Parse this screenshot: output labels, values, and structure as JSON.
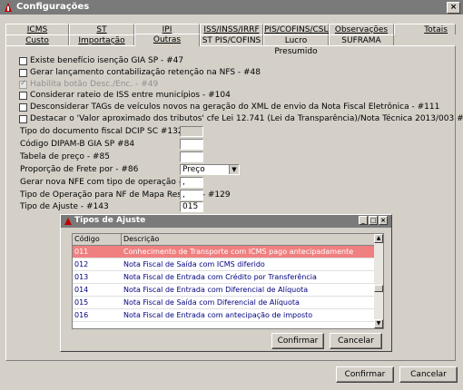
{
  "window": {
    "title": "Configurações",
    "close": "×"
  },
  "tabs_row1": [
    "ICMS",
    "ST",
    "IPI",
    "ISS/INSS/IRRF",
    "PIS/COFINS/CSLL",
    "Observações",
    "Totais"
  ],
  "tabs_row2": [
    "Custo",
    "Importação",
    "Outras",
    "ST PIS/COFINS",
    "Lucro Presumido",
    "SUFRAMA"
  ],
  "checkboxes": [
    {
      "label": "Existe benefício isenção GIA SP - #47",
      "checked": false,
      "disabled": false
    },
    {
      "label": "Gerar lançamento contabilização retenção na NFS - #48",
      "checked": false,
      "disabled": false
    },
    {
      "label": "Habilita botão Desc./Enc. - #49",
      "checked": true,
      "disabled": true
    },
    {
      "label": "Considerar rateio de ISS entre municípios - #104",
      "checked": false,
      "disabled": false
    },
    {
      "label": "Desconsiderar TAGs de veículos novos na geração do XML de envio da Nota Fiscal Eletrônica - #111",
      "checked": false,
      "disabled": false
    },
    {
      "label": "Destacar o 'Valor aproximado dos tributos' cfe Lei 12.741 (Lei da Transparência)/Nota Técnica 2013/003 #130",
      "checked": false,
      "disabled": false
    }
  ],
  "fields": {
    "tipo_doc": {
      "label": "Tipo do documento fiscal DCIP SC #132",
      "value": ""
    },
    "codigo_dipam": {
      "label": "Código DIPAM-B GIA SP  #84",
      "value": ""
    },
    "tabela_preco": {
      "label": "Tabela de preço - #85",
      "value": ""
    },
    "proporcao_frete": {
      "label": "Proporção de Frete por - #86",
      "value": "Preço"
    },
    "gerar_nfe": {
      "label": "Gerar nova NFE com tipo de operação - #88",
      "value": ","
    },
    "tipo_operacao": {
      "label": "Tipo de Operação para NF de Mapa Resumo - #129",
      "value": ","
    },
    "tipo_ajuste": {
      "label": "Tipo de Ajuste - #143",
      "value": "015"
    }
  },
  "popup": {
    "title": "Tipos de Ajuste",
    "columns": [
      "Código",
      "Descrição"
    ],
    "rows": [
      {
        "code": "011",
        "desc": "Conhecimento de Transporte com ICMS pago antecipadamente"
      },
      {
        "code": "012",
        "desc": "Nota Fiscal de Saída com ICMS diferido"
      },
      {
        "code": "013",
        "desc": "Nota Fiscal de Entrada com Crédito por Transferência"
      },
      {
        "code": "014",
        "desc": "Nota Fiscal de Entrada com Diferencial de Alíquota"
      },
      {
        "code": "015",
        "desc": "Nota Fiscal de Saída com Diferencial de Alíquota"
      },
      {
        "code": "016",
        "desc": "Nota Fiscal de Entrada com antecipação de imposto"
      }
    ],
    "selected_index": 0,
    "confirm_label": "Confirmar",
    "cancel_label": "Cancelar"
  },
  "footer": {
    "confirm_label": "Confirmar",
    "cancel_label": "Cancelar"
  },
  "colors": {
    "titlebar": "#7a7a7a",
    "selected_row": "#f08080",
    "link_text": "#000080",
    "face": "#d4d0c8"
  }
}
